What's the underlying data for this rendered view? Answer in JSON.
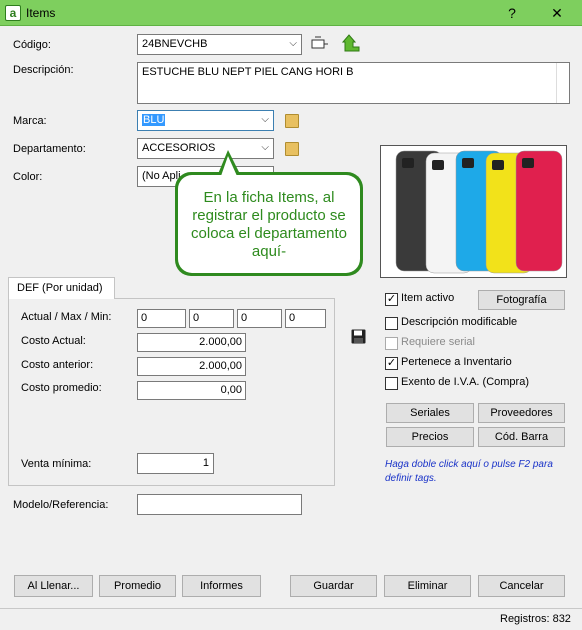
{
  "window": {
    "title": "Items",
    "help_label": "?",
    "close_label": "✕"
  },
  "fields": {
    "codigo": {
      "label": "Código:",
      "value": "24BNEVCHB"
    },
    "descripcion": {
      "label": "Descripción:",
      "value": "ESTUCHE BLU NEPT PIEL CANG HORI B"
    },
    "marca": {
      "label": "Marca:",
      "value": "BLU"
    },
    "departamento": {
      "label": "Departamento:",
      "value": "ACCESORIOS"
    },
    "color": {
      "label": "Color:",
      "value": "(No Apli"
    },
    "modelo": {
      "label": "Modelo/Referencia:",
      "value": ""
    }
  },
  "callout": {
    "text": "En la ficha Items, al registrar el producto se coloca el departamento aquí-"
  },
  "tab": {
    "label": "DEF (Por unidad)"
  },
  "prices": {
    "actual_max_min": {
      "label": "Actual / Max / Min:",
      "values": [
        "0",
        "0",
        "0",
        "0"
      ]
    },
    "costo_actual": {
      "label": "Costo Actual:",
      "value": "2.000,00"
    },
    "costo_anterior": {
      "label": "Costo anterior:",
      "value": "2.000,00"
    },
    "costo_promedio": {
      "label": "Costo promedio:",
      "value": "0,00"
    },
    "venta_minima": {
      "label": "Venta mínima:",
      "value": "1"
    }
  },
  "options": {
    "item_activo": {
      "label": "Item activo",
      "checked": true
    },
    "descripcion_modificable": {
      "label": "Descripción modificable",
      "checked": false
    },
    "requiere_serial": {
      "label": "Requiere serial",
      "checked": false
    },
    "pertenece_inventario": {
      "label": "Pertenece a Inventario",
      "checked": true
    },
    "exento_iva": {
      "label": "Exento de I.V.A. (Compra)",
      "checked": false
    }
  },
  "side_buttons": {
    "fotografia": "Fotografía",
    "seriales": "Seriales",
    "proveedores": "Proveedores",
    "precios": "Precios",
    "cod_barra": "Cód. Barra"
  },
  "hint": "Haga doble click aquí o pulse F2 para definir tags.",
  "bottom_buttons": {
    "al_llenar": "Al Llenar...",
    "promedio": "Promedio",
    "informes": "Informes",
    "guardar": "Guardar",
    "eliminar": "Eliminar",
    "cancelar": "Cancelar"
  },
  "status": {
    "registros": "Registros: 832"
  },
  "colors": {
    "titlebar": "#7ecf5e",
    "accent": "#2f8a1f",
    "hint": "#1a33c8"
  },
  "phone_colors": [
    "#3a3a3a",
    "#f4f4f4",
    "#1ea9e8",
    "#f2e21a",
    "#e0204e"
  ]
}
